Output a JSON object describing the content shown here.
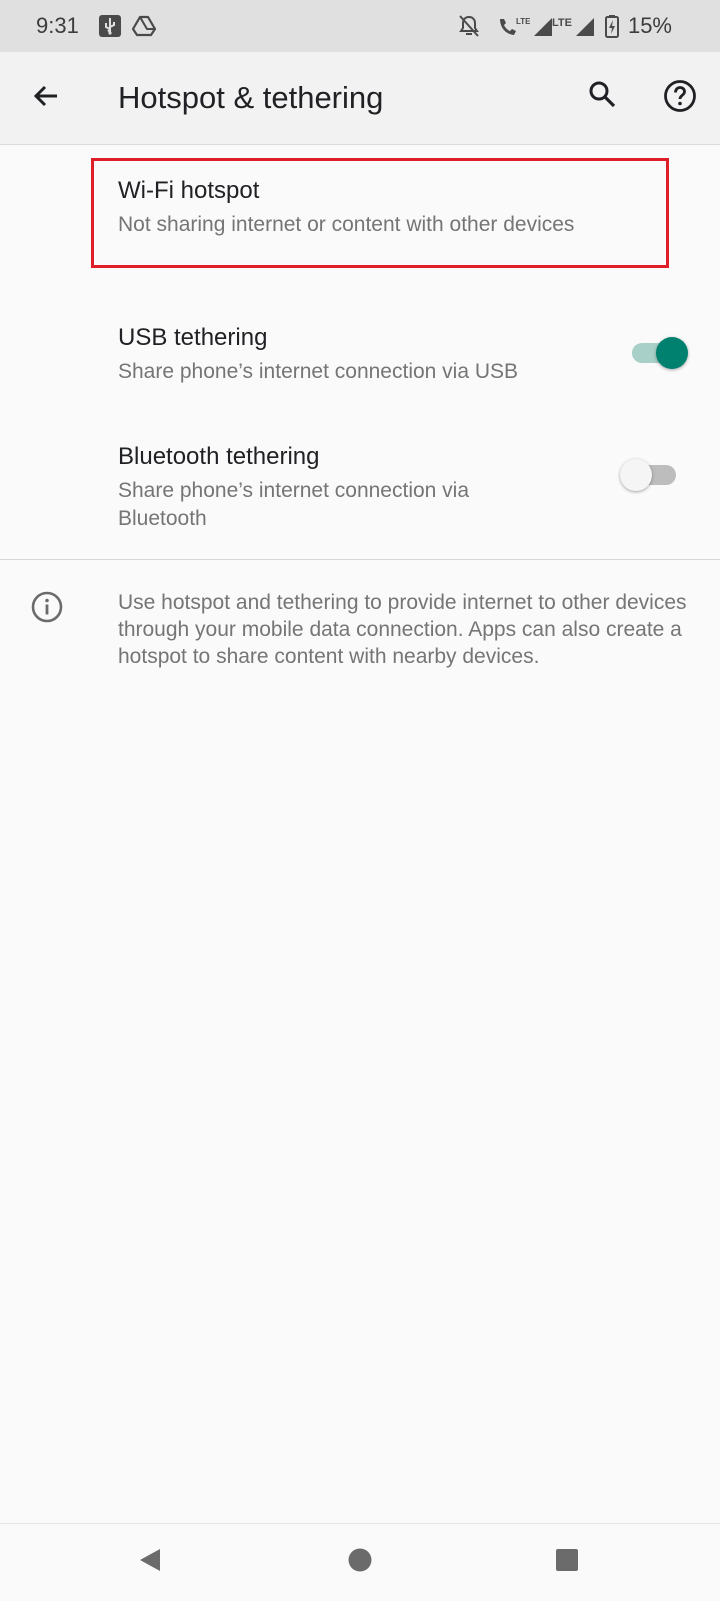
{
  "status_bar": {
    "time": "9:31",
    "battery_percent": "15%",
    "left_icons": [
      "usb-debug-icon",
      "drive-icon"
    ],
    "right_icons": [
      "notifications-off-icon",
      "volte-call-icon",
      "signal-lte-icon",
      "signal-icon",
      "battery-charging-icon"
    ],
    "lte_label": "LTE"
  },
  "app_bar": {
    "title": "Hotspot & tethering",
    "icons": [
      "back-arrow-icon",
      "search-icon",
      "help-icon"
    ]
  },
  "items": [
    {
      "title": "Wi-Fi hotspot",
      "summary": "Not sharing internet or content with other devices",
      "highlighted": true
    },
    {
      "title": "USB tethering",
      "summary": "Share phone’s internet connection via USB",
      "switch_on": true
    },
    {
      "title": "Bluetooth tethering",
      "summary": "Share phone’s internet connection via Bluetooth",
      "switch_on": false
    }
  ],
  "footer": {
    "icon": "info-icon",
    "text": "Use hotspot and tethering to provide internet to other devices through your mobile data connection. Apps can also create a hotspot to share content with nearby devices."
  },
  "nav_bar": {
    "icons": [
      "nav-back-icon",
      "nav-home-icon",
      "nav-recents-icon"
    ]
  },
  "colors": {
    "accent": "#00806e",
    "highlight_border": "#e01e2a",
    "status_bar_bg": "#e0e0e0",
    "app_bar_bg": "#f2f2f2"
  }
}
